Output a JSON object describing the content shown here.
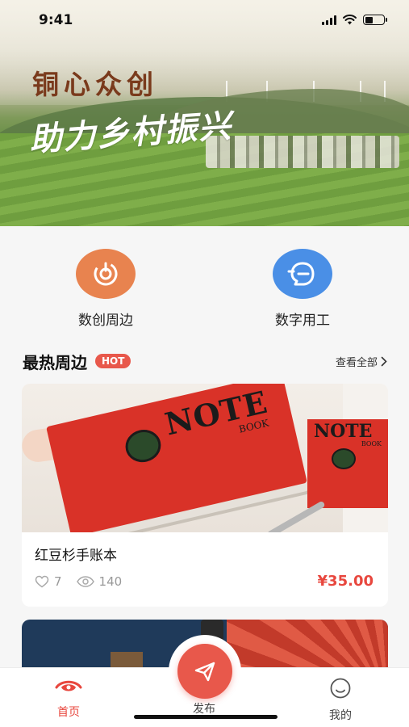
{
  "status_bar": {
    "time": "9:41"
  },
  "hero": {
    "title": "铜心众创",
    "subtitle": "助力乡村振兴"
  },
  "quick_entries": [
    {
      "label": "数创周边",
      "icon": "target-icon",
      "color": "#e8834f"
    },
    {
      "label": "数字用工",
      "icon": "chat-face-icon",
      "color": "#4a8fe6"
    }
  ],
  "section": {
    "title": "最热周边",
    "badge": "HOT",
    "more": "查看全部"
  },
  "product": {
    "name": "红豆杉手账本",
    "likes": "7",
    "views": "140",
    "price": "¥35.00",
    "cover_title": "NOTE",
    "cover_sub": "BOOK"
  },
  "tabbar": {
    "home": "首页",
    "publish": "发布",
    "mine": "我的"
  },
  "colors": {
    "accent": "#e8473e",
    "orange": "#e8834f",
    "blue": "#4a8fe6"
  }
}
